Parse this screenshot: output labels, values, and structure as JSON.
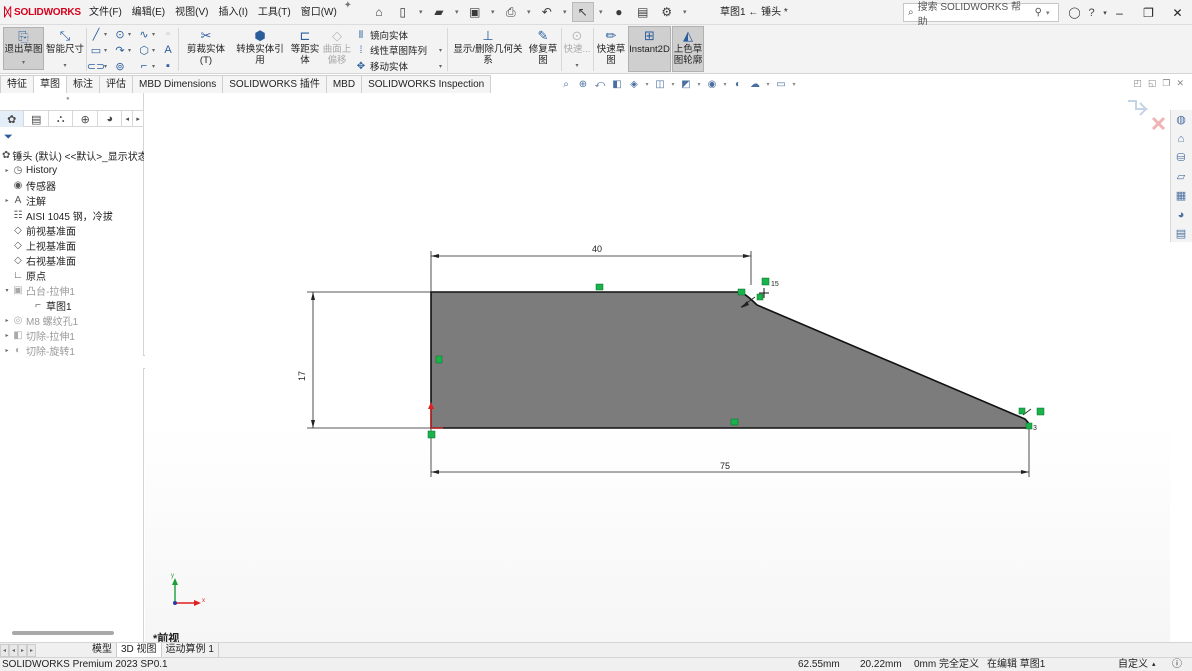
{
  "app": {
    "brand": "SOLIDWORKS",
    "doc_title": "草图1 ← 锤头 *",
    "menus": [
      "文件(F)",
      "编辑(E)",
      "视图(V)",
      "插入(I)",
      "工具(T)",
      "窗口(W)"
    ],
    "search_placeholder": "搜索 SOLIDWORKS 帮助"
  },
  "ribbon": {
    "exit_sketch": "退出草图",
    "smart_dim": "智能尺寸",
    "trim": "剪裁实体(T)",
    "convert": "转换实体引用",
    "offset_line1": "等距实",
    "offset_line2": "体",
    "surface_offset_line1": "曲面上",
    "surface_offset_line2": "偏移",
    "mirror": "镜向实体",
    "linear_pattern": "线性草图阵列",
    "move": "移动实体",
    "relations": "显示/删除几何关系",
    "repair_line1": "修复草",
    "repair_line2": "图",
    "quick_snaps": "快速...",
    "rapid_sketch_line1": "快速草",
    "rapid_sketch_line2": "图",
    "instant2d": "Instant2D",
    "shaded_line1": "上色草",
    "shaded_line2": "图轮廓"
  },
  "tabs": [
    "特征",
    "草图",
    "标注",
    "评估",
    "MBD Dimensions",
    "SOLIDWORKS 插件",
    "MBD",
    "SOLIDWORKS Inspection"
  ],
  "active_tab": "草图",
  "tree": [
    {
      "label": "锤头 (默认) <<默认>_显示状态",
      "icon": "part-icon",
      "exp": "",
      "indent": 0,
      "grey": false
    },
    {
      "label": "History",
      "icon": "history-icon",
      "exp": "▸",
      "indent": 0,
      "grey": false
    },
    {
      "label": "传感器",
      "icon": "sensor-icon",
      "exp": "",
      "indent": 0,
      "grey": false
    },
    {
      "label": "注解",
      "icon": "annotation-icon",
      "exp": "▸",
      "indent": 0,
      "grey": false
    },
    {
      "label": "AISI 1045 钢，冷拔",
      "icon": "material-icon",
      "exp": "",
      "indent": 0,
      "grey": false
    },
    {
      "label": "前视基准面",
      "icon": "plane-icon",
      "exp": "",
      "indent": 0,
      "grey": false
    },
    {
      "label": "上视基准面",
      "icon": "plane-icon",
      "exp": "",
      "indent": 0,
      "grey": false
    },
    {
      "label": "右视基准面",
      "icon": "plane-icon",
      "exp": "",
      "indent": 0,
      "grey": false
    },
    {
      "label": "原点",
      "icon": "origin-icon",
      "exp": "",
      "indent": 0,
      "grey": false
    },
    {
      "label": "凸台-拉伸1",
      "icon": "extrude-icon",
      "exp": "▾",
      "indent": 0,
      "grey": true
    },
    {
      "label": "草图1",
      "icon": "sketch-icon",
      "exp": "",
      "indent": 1,
      "grey": false
    },
    {
      "label": "M8 螺纹孔1",
      "icon": "hole-icon",
      "exp": "▸",
      "indent": 0,
      "grey": true
    },
    {
      "label": "切除-拉伸1",
      "icon": "cut-icon",
      "exp": "▸",
      "indent": 0,
      "grey": true
    },
    {
      "label": "切除-旋转1",
      "icon": "revolve-cut-icon",
      "exp": "▸",
      "indent": 0,
      "grey": true
    }
  ],
  "viewport": {
    "view_name": "*前视",
    "dims": {
      "top": "40",
      "left": "17",
      "bottom": "75",
      "fillet_top": "15",
      "fillet_bottom": "3"
    },
    "triad": {
      "x": "x",
      "y": "y"
    }
  },
  "bottom_tabs": [
    "模型",
    "3D 视图",
    "运动算例 1"
  ],
  "status": {
    "product": "SOLIDWORKS Premium 2023 SP0.1",
    "x": "62.55mm",
    "y": "20.22mm",
    "z": "0mm",
    "state": "完全定义",
    "editing": "在编辑 草图1",
    "units": "自定义"
  },
  "colors": {
    "brand": "#d6001c",
    "sketch_fill": "#7c7c7c",
    "relation_marker": "#19b34b"
  }
}
